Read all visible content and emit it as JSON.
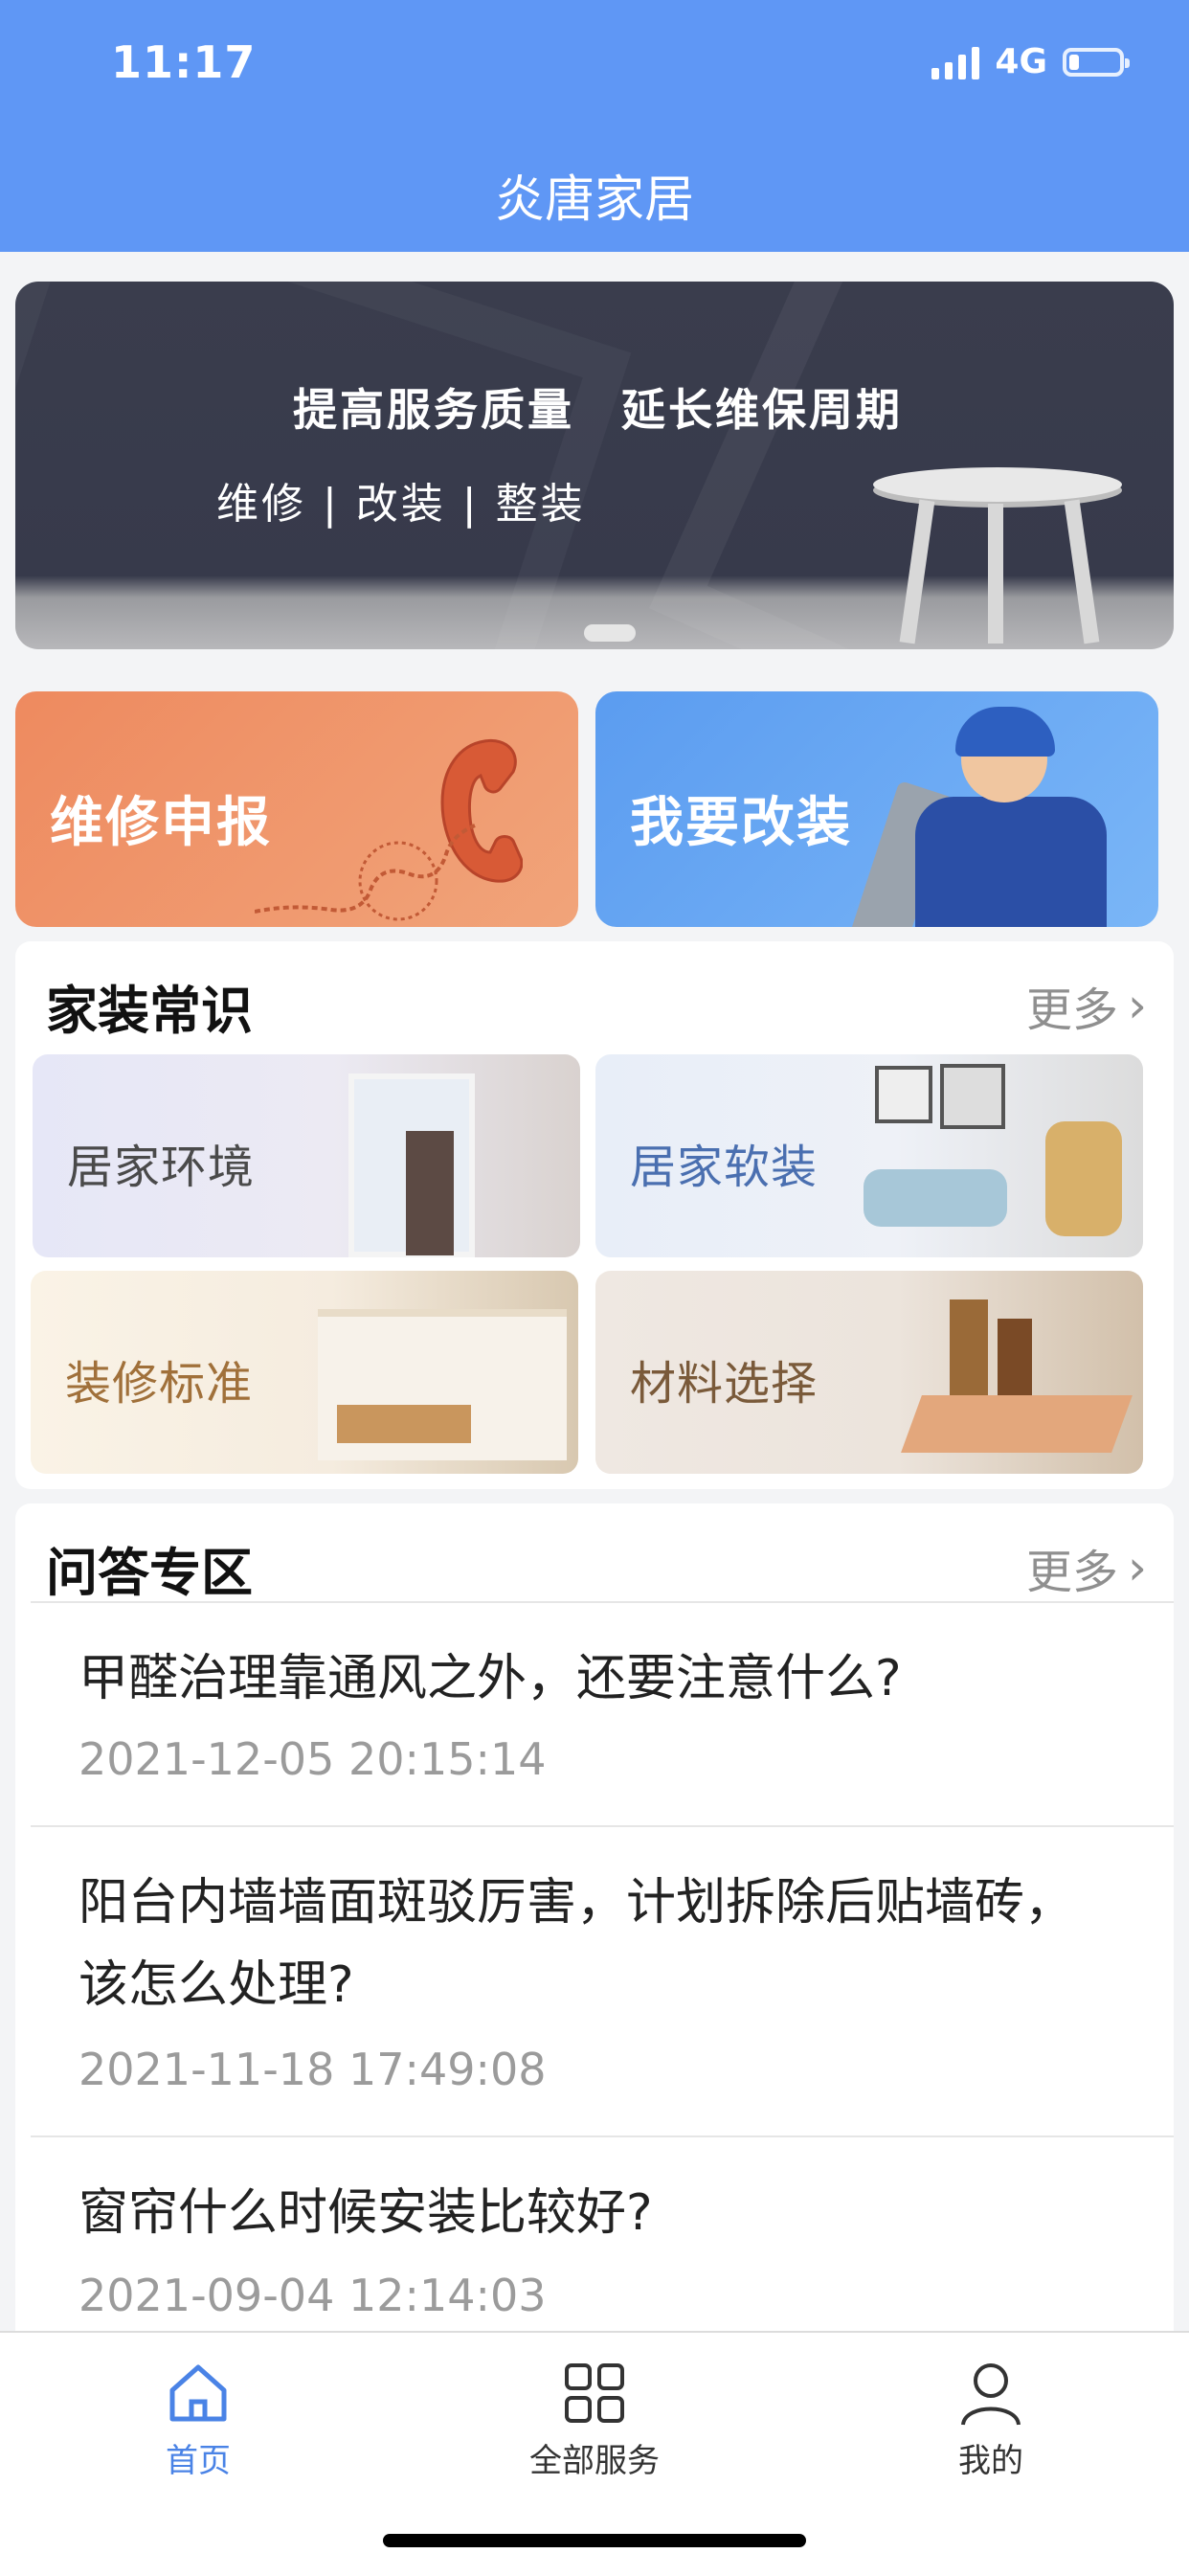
{
  "status": {
    "time": "11:17",
    "network": "4G"
  },
  "header": {
    "title": "炎唐家居"
  },
  "banner": {
    "headline": "提高服务质量　延长维保周期",
    "subline": "维修 | 改装 | 整装"
  },
  "actions": [
    {
      "label": "维修申报",
      "icon": "telephone-icon"
    },
    {
      "label": "我要改装",
      "icon": "worker-icon"
    }
  ],
  "knowledge": {
    "title": "家装常识",
    "more": "更多",
    "tiles": [
      {
        "label": "居家环境"
      },
      {
        "label": "居家软装"
      },
      {
        "label": "装修标准"
      },
      {
        "label": "材料选择"
      }
    ]
  },
  "qa": {
    "title": "问答专区",
    "more": "更多",
    "items": [
      {
        "question": "甲醛治理靠通风之外，还要注意什么?",
        "date": "2021-12-05 20:15:14"
      },
      {
        "question": "阳台内墙墙面斑驳厉害，计划拆除后贴墙砖，该怎么处理?",
        "date": "2021-11-18 17:49:08"
      },
      {
        "question": "窗帘什么时候安装比较好?",
        "date": "2021-09-04 12:14:03"
      }
    ]
  },
  "tabs": [
    {
      "label": "首页",
      "icon": "home-icon",
      "active": true
    },
    {
      "label": "全部服务",
      "icon": "grid-icon",
      "active": false
    },
    {
      "label": "我的",
      "icon": "user-icon",
      "active": false
    }
  ],
  "colors": {
    "primary": "#5f97f5",
    "accent_orange": "#ee8a5f",
    "tab_active": "#4a83e6"
  }
}
